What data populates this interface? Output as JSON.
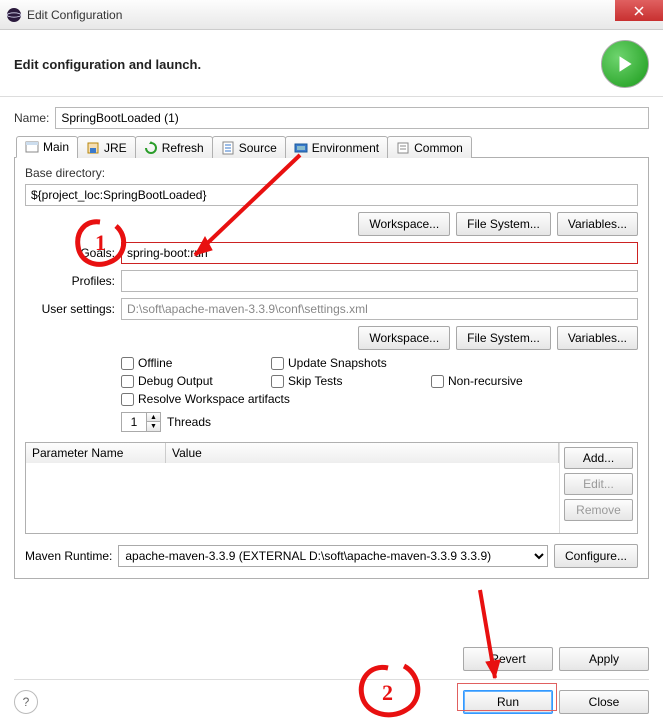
{
  "window": {
    "title": "Edit Configuration"
  },
  "header": {
    "text": "Edit configuration and launch."
  },
  "name": {
    "label": "Name:",
    "value": "SpringBootLoaded (1)"
  },
  "tabs": {
    "items": [
      {
        "label": "Main"
      },
      {
        "label": "JRE"
      },
      {
        "label": "Refresh"
      },
      {
        "label": "Source"
      },
      {
        "label": "Environment"
      },
      {
        "label": "Common"
      }
    ]
  },
  "main": {
    "base_label": "Base directory:",
    "base_value": "${project_loc:SpringBootLoaded}",
    "buttons": {
      "workspace": "Workspace...",
      "filesystem": "File System...",
      "variables": "Variables..."
    },
    "goals_label": "Goals:",
    "goals_value": "spring-boot:run",
    "profiles_label": "Profiles:",
    "profiles_value": "",
    "usersettings_label": "User settings:",
    "usersettings_value": "D:\\soft\\apache-maven-3.3.9\\conf\\settings.xml",
    "checks": {
      "offline": "Offline",
      "update": "Update Snapshots",
      "debug": "Debug Output",
      "skip": "Skip Tests",
      "nonrec": "Non-recursive",
      "resolve": "Resolve Workspace artifacts"
    },
    "threads_value": "1",
    "threads_label": "Threads",
    "table": {
      "col1": "Parameter Name",
      "col2": "Value",
      "add": "Add...",
      "edit": "Edit...",
      "remove": "Remove"
    },
    "maven_label": "Maven Runtime:",
    "maven_value": "apache-maven-3.3.9 (EXTERNAL D:\\soft\\apache-maven-3.3.9 3.3.9)",
    "configure": "Configure..."
  },
  "footer": {
    "revert": "Revert",
    "apply": "Apply",
    "run": "Run",
    "close": "Close"
  },
  "annotations": {
    "one": "1",
    "two": "2"
  }
}
